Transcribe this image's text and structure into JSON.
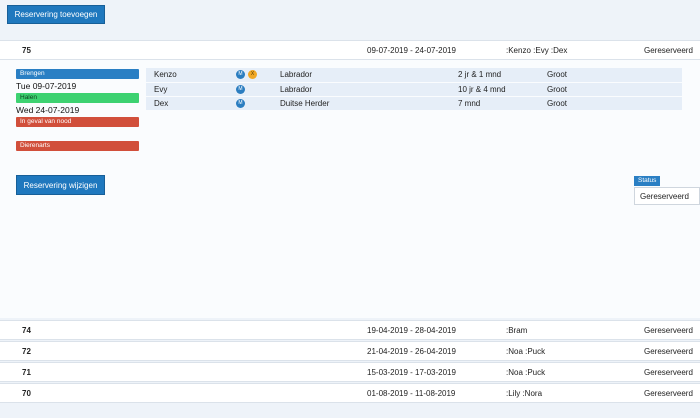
{
  "toolbar": {
    "add_label": "Reservering toevoegen"
  },
  "selected": {
    "number": "75",
    "dates": "09-07-2019 - 24-07-2019",
    "dogs": ":Kenzo :Evy :Dex",
    "status": "Gereserveerd",
    "bring_label": "Brengen",
    "bring_date": "Tue 09-07-2019",
    "get_label": "Halen",
    "get_date": "Wed 24-07-2019",
    "emergency_label": "In geval van nood",
    "vet_label": "Dierenarts",
    "animals": [
      {
        "name": "Kenzo",
        "icons": [
          "m",
          "x"
        ],
        "icon_text": [
          "M",
          "X"
        ],
        "breed": "Labrador",
        "age": "2 jr & 1 mnd",
        "size": "Groot"
      },
      {
        "name": "Evy",
        "icons": [
          "m"
        ],
        "icon_text": [
          "M"
        ],
        "breed": "Labrador",
        "age": "10 jr & 4 mnd",
        "size": "Groot"
      },
      {
        "name": "Dex",
        "icons": [
          "m"
        ],
        "icon_text": [
          "M"
        ],
        "breed": "Duitse Herder",
        "age": "7 mnd",
        "size": "Groot"
      }
    ],
    "edit_label": "Reservering wijzigen",
    "status_field_label": "Status",
    "status_value": "Gereserveerd"
  },
  "reservations": [
    {
      "number": "74",
      "dates": "19-04-2019 - 28-04-2019",
      "dogs": ":Bram",
      "status": "Gereserveerd"
    },
    {
      "number": "72",
      "dates": "21-04-2019 - 26-04-2019",
      "dogs": ":Noa :Puck",
      "status": "Gereserveerd"
    },
    {
      "number": "71",
      "dates": "15-03-2019 - 17-03-2019",
      "dogs": ":Noa :Puck",
      "status": "Gereserveerd"
    },
    {
      "number": "70",
      "dates": "01-08-2019 - 11-08-2019",
      "dogs": ":Lily :Nora",
      "status": "Gereserveerd"
    }
  ],
  "colors": {
    "primary": "#1f78be",
    "success": "#3dd271",
    "danger": "#d14f3b",
    "background": "#eef3f9"
  }
}
